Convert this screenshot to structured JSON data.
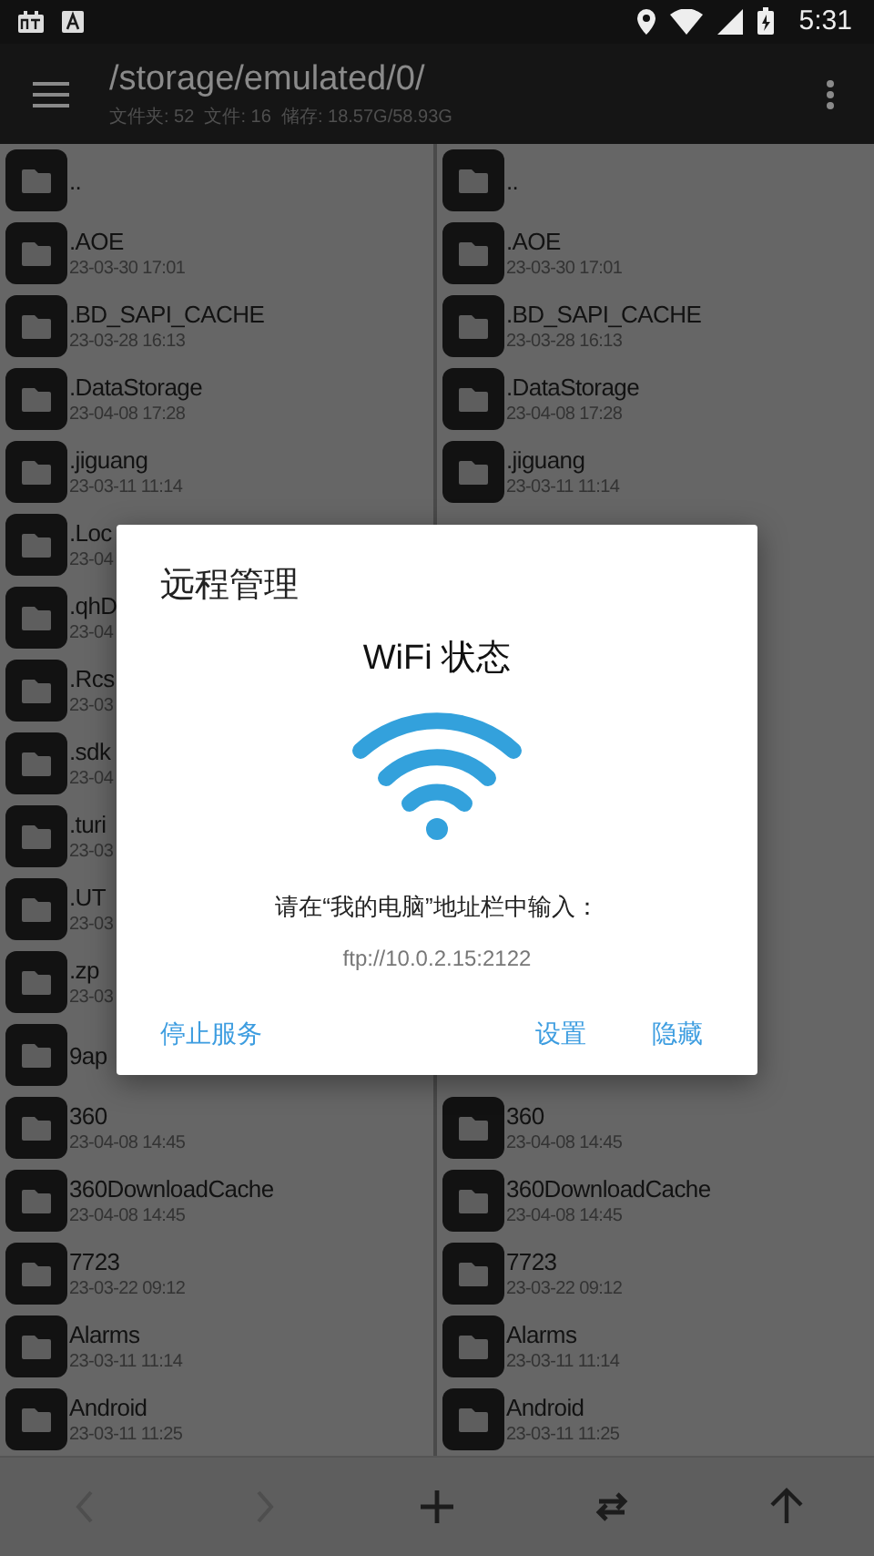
{
  "status_bar": {
    "time": "5:31"
  },
  "app_bar": {
    "path": "/storage/emulated/0/",
    "summary": "文件夹: 52  文件: 16  储存: 18.57G/58.93G"
  },
  "rows": [
    {
      "left": {
        "name": ".."
      },
      "right": {
        "name": ".."
      }
    },
    {
      "left": {
        "name": ".AOE",
        "date": "23-03-30 17:01"
      },
      "right": {
        "name": ".AOE",
        "date": "23-03-30 17:01"
      }
    },
    {
      "left": {
        "name": ".BD_SAPI_CACHE",
        "date": "23-03-28 16:13"
      },
      "right": {
        "name": ".BD_SAPI_CACHE",
        "date": "23-03-28 16:13"
      }
    },
    {
      "left": {
        "name": ".DataStorage",
        "date": "23-04-08 17:28"
      },
      "right": {
        "name": ".DataStorage",
        "date": "23-04-08 17:28"
      }
    },
    {
      "left": {
        "name": ".jiguang",
        "date": "23-03-11 11:14"
      },
      "right": {
        "name": ".jiguang",
        "date": "23-03-11 11:14"
      }
    },
    {
      "left": {
        "name": ".Loc",
        "date": "23-04"
      }
    },
    {
      "left": {
        "name": ".qhD",
        "date": "23-04"
      }
    },
    {
      "left": {
        "name": ".Rcs",
        "date": "23-03"
      }
    },
    {
      "left": {
        "name": ".sdk",
        "date": "23-04"
      }
    },
    {
      "left": {
        "name": ".turi",
        "date": "23-03"
      }
    },
    {
      "left": {
        "name": ".UT",
        "date": "23-03"
      }
    },
    {
      "left": {
        "name": ".zp",
        "date": "23-03"
      }
    },
    {
      "left": {
        "name": "9ap"
      }
    },
    {
      "left": {
        "name": "360",
        "date": "23-04-08 14:45"
      },
      "right": {
        "name": "360",
        "date": "23-04-08 14:45"
      }
    },
    {
      "left": {
        "name": "360DownloadCache",
        "date": "23-04-08 14:45"
      },
      "right": {
        "name": "360DownloadCache",
        "date": "23-04-08 14:45"
      }
    },
    {
      "left": {
        "name": "7723",
        "date": "23-03-22 09:12"
      },
      "right": {
        "name": "7723",
        "date": "23-03-22 09:12"
      }
    },
    {
      "left": {
        "name": "Alarms",
        "date": "23-03-11 11:14"
      },
      "right": {
        "name": "Alarms",
        "date": "23-03-11 11:14"
      }
    },
    {
      "left": {
        "name": "Android",
        "date": "23-03-11 11:25"
      },
      "right": {
        "name": "Android",
        "date": "23-03-11 11:25"
      }
    }
  ],
  "dialog": {
    "title": "远程管理",
    "heading": "WiFi 状态",
    "instruction": "请在“我的电脑”地址栏中输入：",
    "address": "ftp://10.0.2.15:2122",
    "buttons": [
      {
        "label": "停止服务",
        "kind": "left"
      },
      {
        "label": "设置",
        "kind": "right"
      },
      {
        "label": "隐藏",
        "kind": "right"
      }
    ]
  },
  "bottom_bar": [
    {
      "kind": "back",
      "disabled": true
    },
    {
      "kind": "forward",
      "disabled": true
    },
    {
      "kind": "add",
      "disabled": false
    },
    {
      "kind": "swap",
      "disabled": false
    },
    {
      "kind": "up",
      "disabled": false
    }
  ]
}
